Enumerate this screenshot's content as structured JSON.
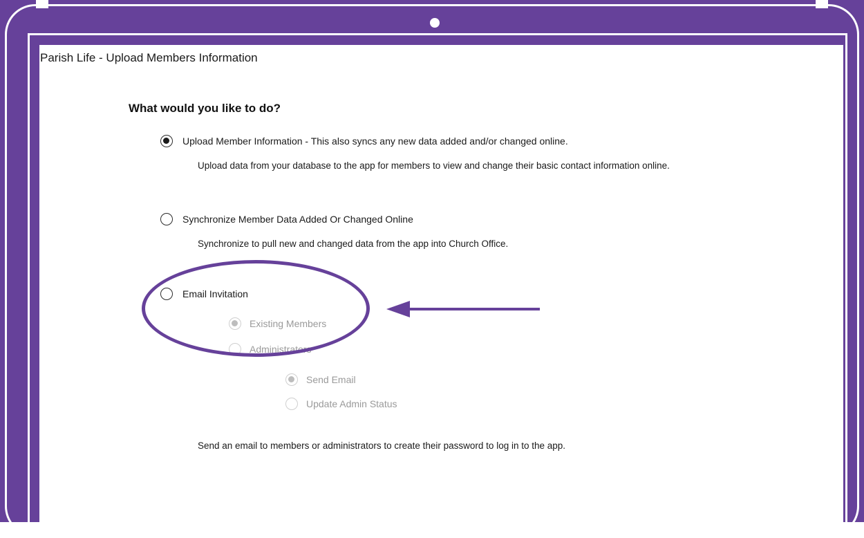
{
  "window": {
    "title": "Parish Life - Upload Members Information"
  },
  "heading": "What would you like to do?",
  "options": [
    {
      "label": "Upload Member Information - This also syncs any new data added and/or changed online.",
      "description": "Upload data from your database to the app for members to view and change their basic contact information online.",
      "selected": true
    },
    {
      "label": "Synchronize Member Data Added Or Changed Online",
      "description": "Synchronize to pull new and changed data from the app into Church Office.",
      "selected": false
    },
    {
      "label": "Email Invitation",
      "selected": false,
      "suboptions": [
        {
          "label": "Existing Members",
          "selected": true,
          "enabled": false
        },
        {
          "label": "Administrators",
          "selected": false,
          "enabled": false
        }
      ],
      "admin_suboptions": [
        {
          "label": "Send Email",
          "selected": true,
          "enabled": false
        },
        {
          "label": "Update Admin Status",
          "selected": false,
          "enabled": false
        }
      ],
      "description": "Send an email to members or administrators to create their password to log in to the app."
    }
  ],
  "colors": {
    "frame": "#66419a",
    "annotation": "#66419a",
    "disabled_text": "#9a9a9a"
  },
  "annotation": {
    "shape": "ellipse-highlight",
    "arrow": "arrow-left"
  }
}
